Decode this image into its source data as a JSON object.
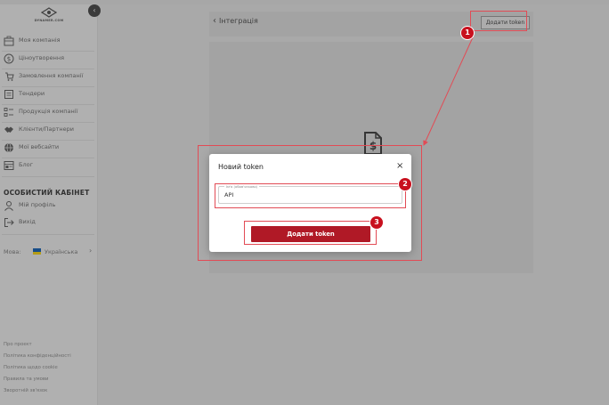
{
  "sidebar": {
    "logo_text": "DYNAMER.COM",
    "items": [
      {
        "label": "Моя компанія",
        "icon": "building-icon"
      },
      {
        "label": "Ціноутворення",
        "icon": "dollar-icon"
      },
      {
        "label": "Замовлення компанії",
        "icon": "cart-icon"
      },
      {
        "label": "Тендери",
        "icon": "tender-icon"
      },
      {
        "label": "Продукція компанії",
        "icon": "product-list-icon"
      },
      {
        "label": "Клієнти/Партнери",
        "icon": "handshake-icon"
      },
      {
        "label": "Мої вебсайти",
        "icon": "globe-icon"
      },
      {
        "label": "Блог",
        "icon": "blog-icon"
      }
    ],
    "cabinet_title": "ОСОБИСТИЙ КАБІНЕТ",
    "cabinet_items": [
      {
        "label": "Мій профіль",
        "icon": "user-icon"
      },
      {
        "label": "Вихід",
        "icon": "logout-icon"
      }
    ],
    "language": {
      "label": "Мова:",
      "value": "Українська"
    },
    "footer_links": [
      "Про проєкт",
      "Політика конфіденційності",
      "Політика щодо cookie",
      "Правила та умови",
      "Зворотній зв'язок"
    ]
  },
  "header": {
    "back_label": "Інтеграція",
    "add_token_label": "Додати token"
  },
  "modal": {
    "title": "Новий token",
    "close_label": "×",
    "field_legend": "Ім'я (обов'язково)",
    "field_value": "API",
    "submit_label": "Додати token"
  },
  "steps": [
    "1",
    "2",
    "3"
  ],
  "colors": {
    "accent": "#b01926",
    "highlight": "#e24b55",
    "flag_blue": "#0057b7",
    "flag_yellow": "#ffd700"
  }
}
